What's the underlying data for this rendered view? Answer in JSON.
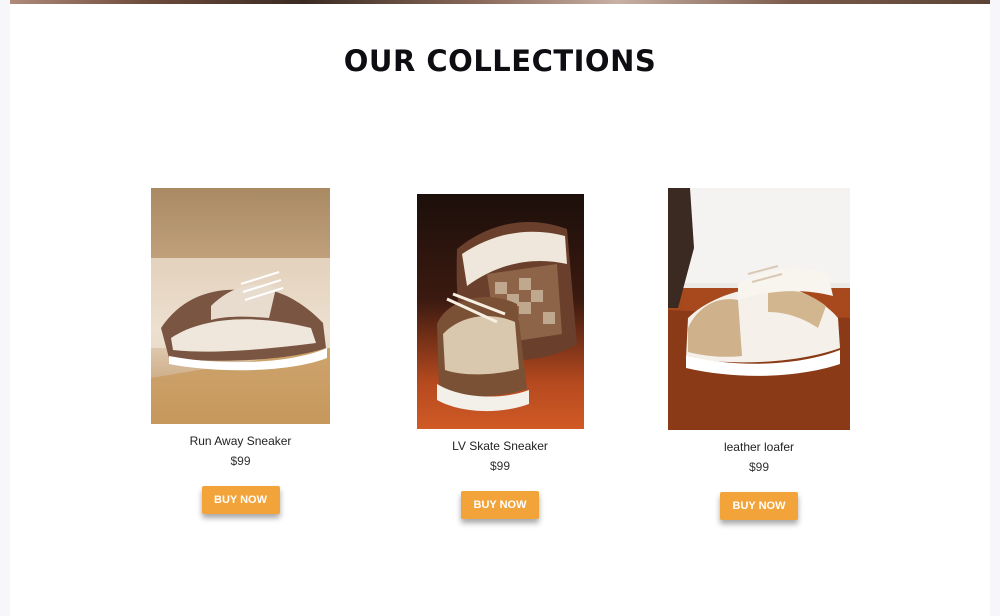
{
  "section": {
    "title": "OUR COLLECTIONS"
  },
  "products": [
    {
      "name": "Run Away Sneaker",
      "price": "$99",
      "button_label": "BUY NOW",
      "image_icon": "sneaker-photo"
    },
    {
      "name": "LV Skate Sneaker",
      "price": "$99",
      "button_label": "BUY NOW",
      "image_icon": "sneaker-photo"
    },
    {
      "name": "leather loafer",
      "price": "$99",
      "button_label": "BUY NOW",
      "image_icon": "sneaker-photo"
    }
  ],
  "colors": {
    "accent": "#f2a33a",
    "title": "#0d0d12",
    "page_bg": "#ffffff"
  }
}
